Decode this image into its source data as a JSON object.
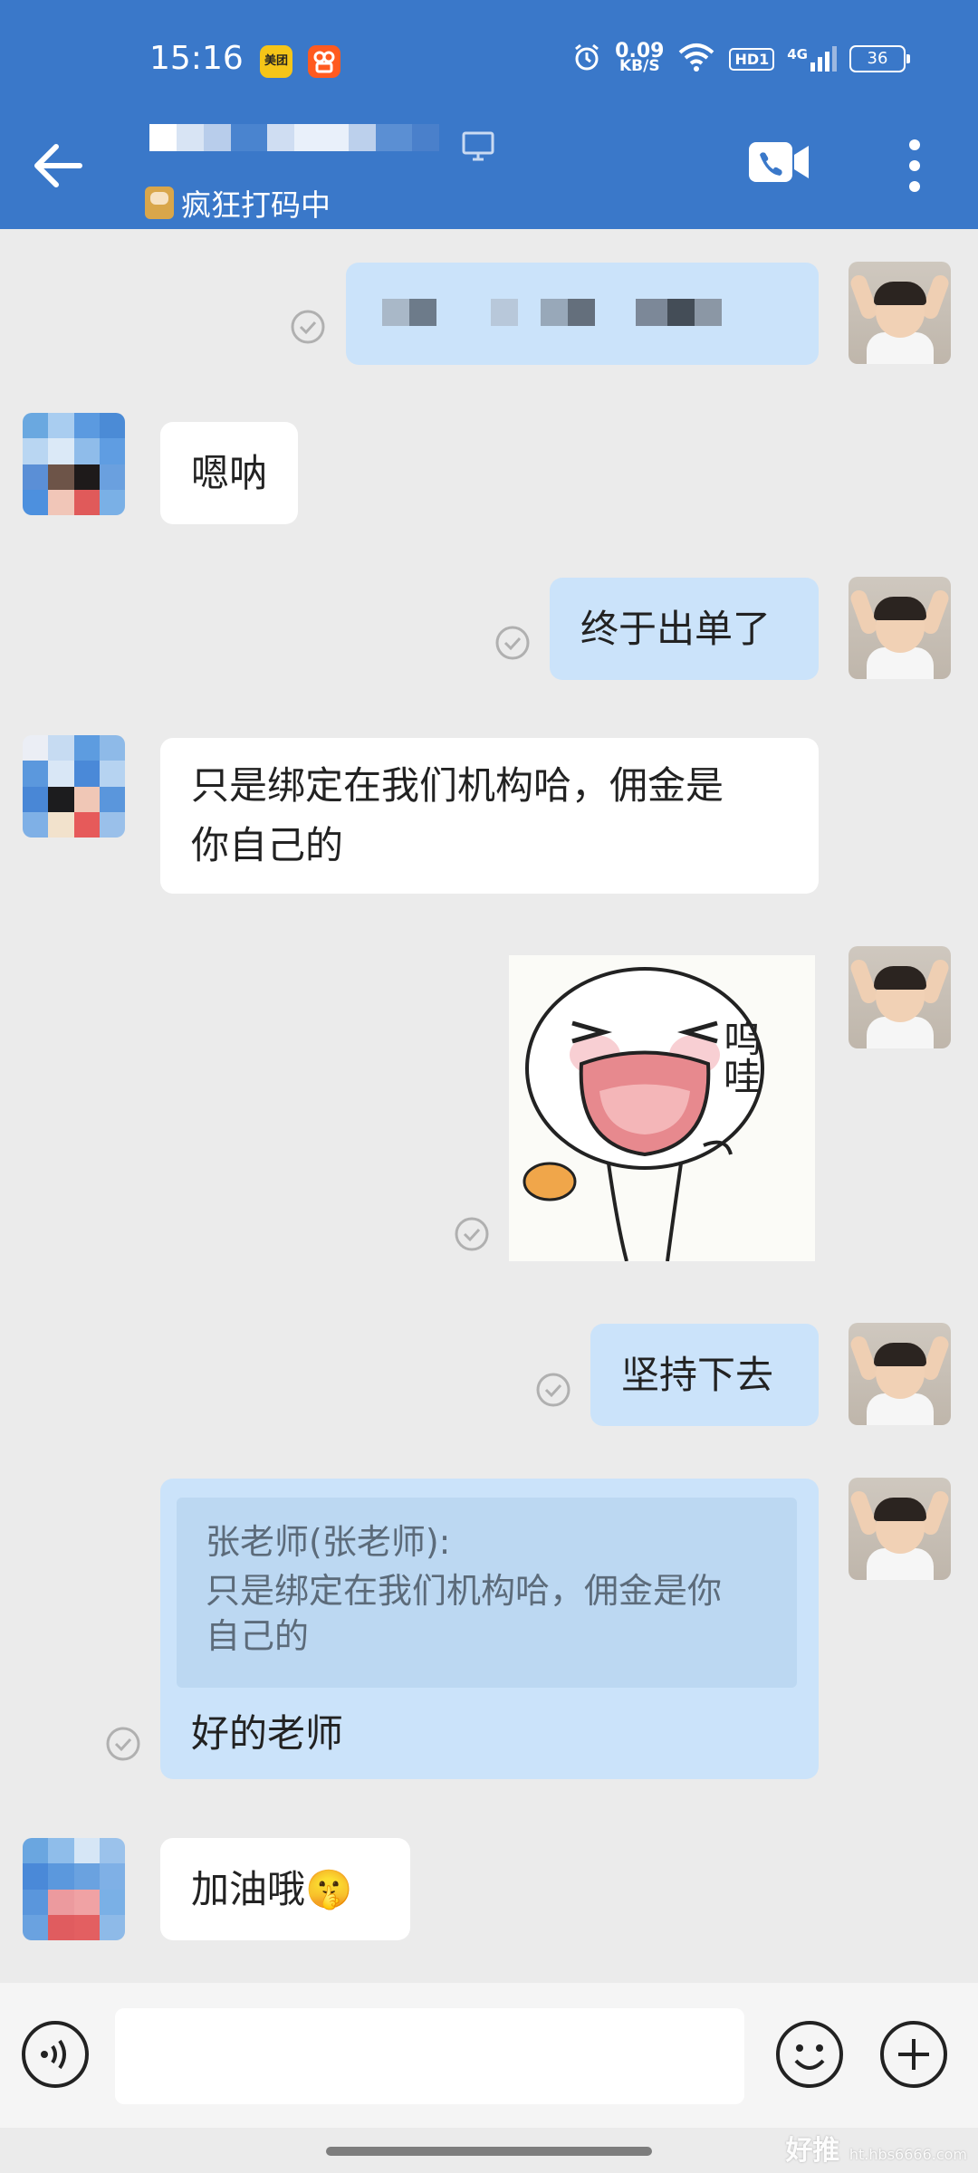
{
  "status_bar": {
    "time": "15:16",
    "app_badge_1": "美团",
    "app_badge_2": "",
    "net_speed_value": "0.09",
    "net_speed_unit": "KB/S",
    "hd_label": "HD1",
    "signal_label": "4G",
    "battery": "36"
  },
  "header": {
    "status_text": "疯狂打码中",
    "accent_color": "#3a78c9"
  },
  "messages": [
    {
      "side": "me",
      "kind": "redacted-text",
      "text": ""
    },
    {
      "side": "other",
      "kind": "text",
      "text": "嗯呐"
    },
    {
      "side": "me",
      "kind": "text",
      "text": "终于出单了"
    },
    {
      "side": "other",
      "kind": "text",
      "line1": "只是绑定在我们机构哈，佣金是",
      "line2": "你自己的"
    },
    {
      "side": "me",
      "kind": "sticker",
      "sticker_text": "呜哇"
    },
    {
      "side": "me",
      "kind": "text",
      "text": "坚持下去"
    },
    {
      "side": "me",
      "kind": "reply",
      "quote_author": "张老师(张老师):",
      "quote_line1": "只是绑定在我们机构哈，佣金是你",
      "quote_line2": "自己的",
      "text": "好的老师"
    },
    {
      "side": "other",
      "kind": "text",
      "text": "加油哦",
      "emoji": "🤫"
    }
  ],
  "input": {
    "value": "",
    "placeholder": ""
  },
  "watermark": {
    "main": "好推",
    "sub": "ht.hbs6666.com"
  }
}
